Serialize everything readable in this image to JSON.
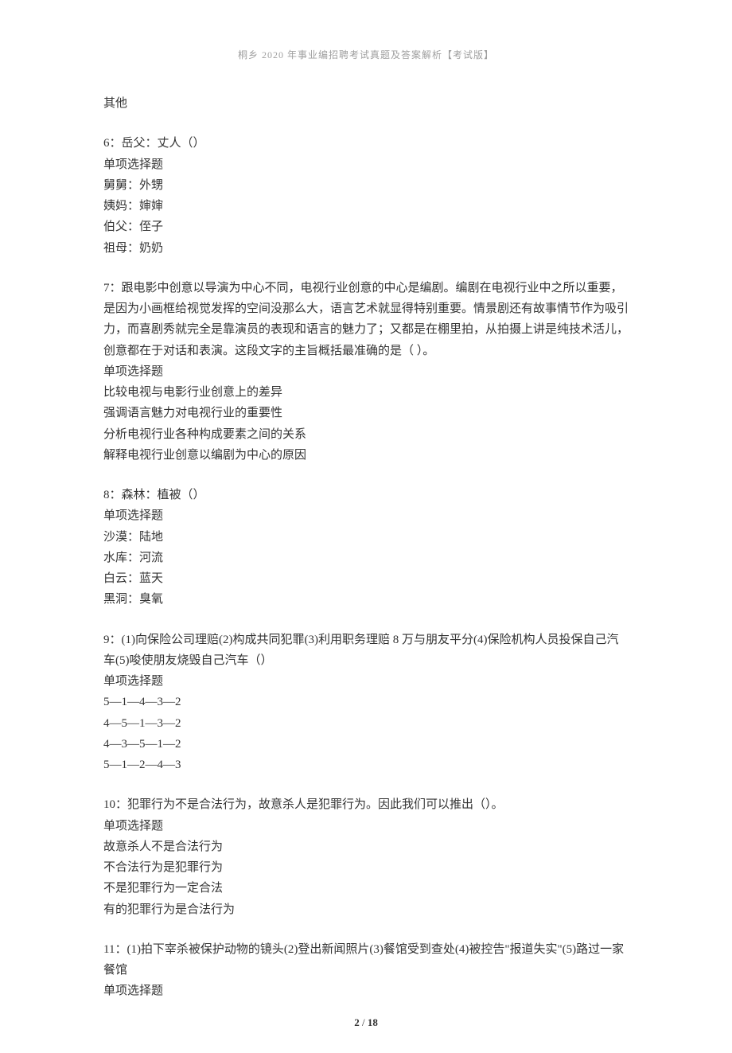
{
  "header": "桐乡 2020 年事业编招聘考试真题及答案解析【考试版】",
  "blocks": [
    {
      "lines": [
        "其他"
      ]
    },
    {
      "lines": [
        "6：岳父：丈人（）",
        "单项选择题",
        "舅舅：外甥",
        "姨妈：婶婶",
        "伯父：侄子",
        "祖母：奶奶"
      ]
    },
    {
      "lines": [
        "7：跟电影中创意以导演为中心不同，电视行业创意的中心是编剧。编剧在电视行业中之所以重要，是因为小画框给视觉发挥的空间没那么大，语言艺术就显得特别重要。情景剧还有故事情节作为吸引力，而喜剧秀就完全是靠演员的表现和语言的魅力了；又都是在棚里拍，从拍摄上讲是纯技术活儿，创意都在于对话和表演。这段文字的主旨概括最准确的是（ ）。",
        "单项选择题",
        "比较电视与电影行业创意上的差异",
        "强调语言魅力对电视行业的重要性",
        "分析电视行业各种构成要素之间的关系",
        "解释电视行业创意以编剧为中心的原因"
      ]
    },
    {
      "lines": [
        "8：森林：植被（）",
        "单项选择题",
        "沙漠：陆地",
        "水库：河流",
        "白云：蓝天",
        "黑洞：臭氧"
      ]
    },
    {
      "lines": [
        "9：(1)向保险公司理赔(2)构成共同犯罪(3)利用职务理赔 8 万与朋友平分(4)保险机构人员投保自己汽车(5)唆使朋友烧毁自己汽车（）",
        "单项选择题",
        "5—1—4—3—2",
        "4—5—1—3—2",
        "4—3—5—1—2",
        "5—1—2—4—3"
      ]
    },
    {
      "lines": [
        "10：犯罪行为不是合法行为，故意杀人是犯罪行为。因此我们可以推出（）。",
        "单项选择题",
        "故意杀人不是合法行为",
        "不合法行为是犯罪行为",
        "不是犯罪行为一定合法",
        "有的犯罪行为是合法行为"
      ]
    },
    {
      "lines": [
        "11：(1)拍下宰杀被保护动物的镜头(2)登出新闻照片(3)餐馆受到查处(4)被控告\"报道失实\"(5)路过一家餐馆",
        "单项选择题"
      ]
    }
  ],
  "pagination": {
    "current": "2",
    "sep": " / ",
    "total": "18"
  }
}
